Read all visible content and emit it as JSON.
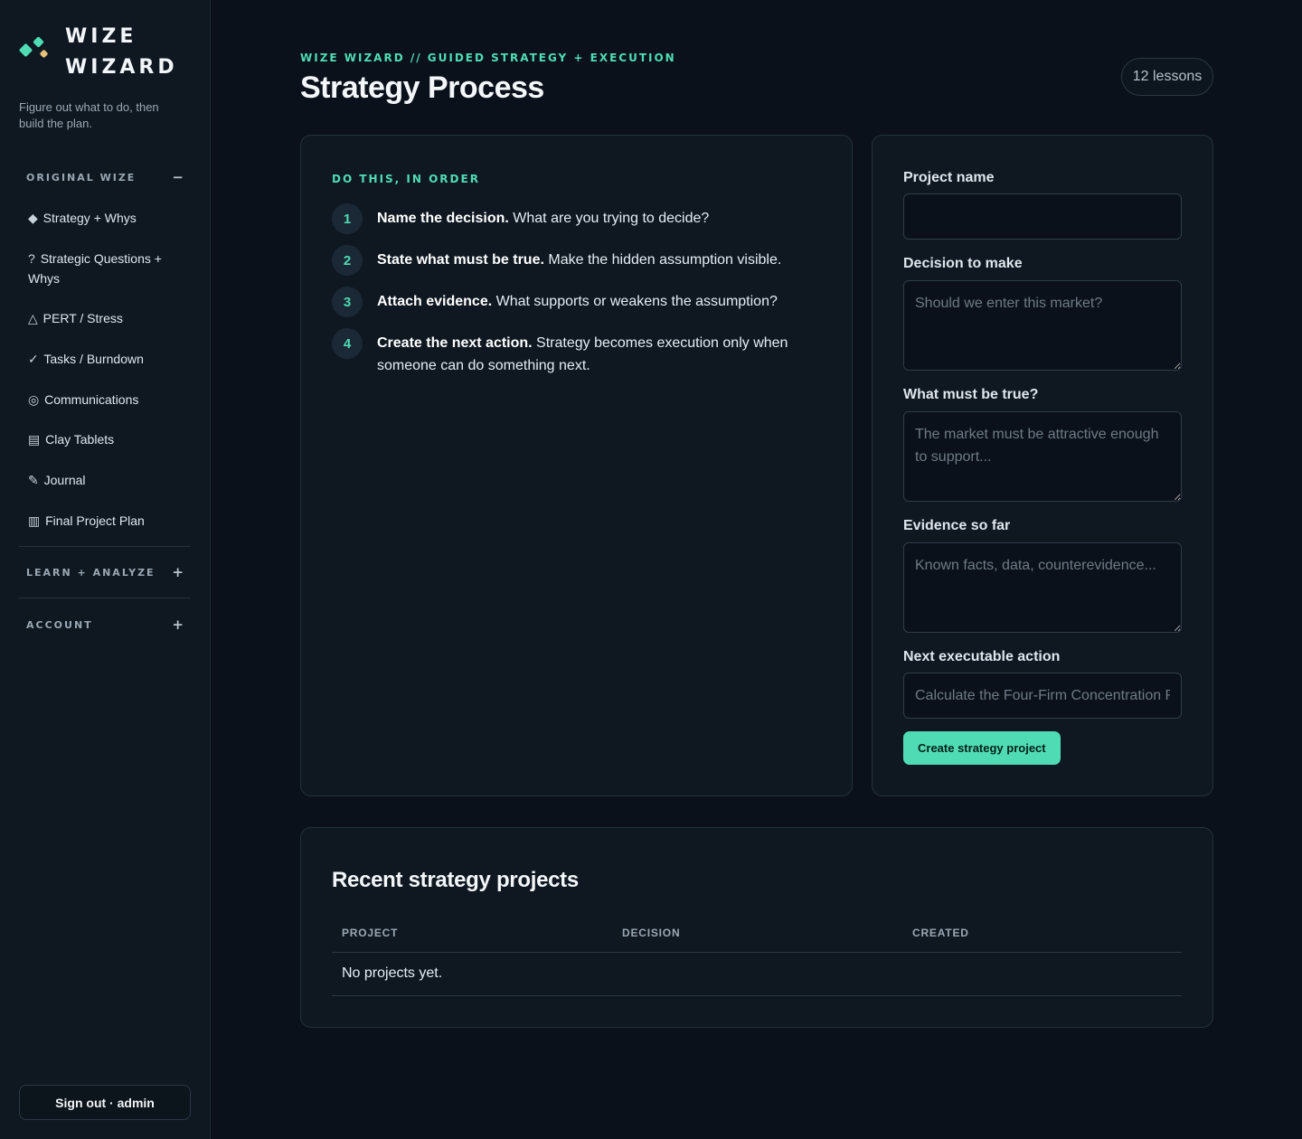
{
  "brand": {
    "line1": "WIZE",
    "line2": "WIZARD",
    "tagline": "Figure out what to do, then build the plan."
  },
  "sidebar": {
    "sections": [
      {
        "title": "ORIGINAL WIZE",
        "toggle": "−",
        "expanded": true
      },
      {
        "title": "LEARN + ANALYZE",
        "toggle": "+",
        "expanded": false
      },
      {
        "title": "ACCOUNT",
        "toggle": "+",
        "expanded": false
      }
    ],
    "items": [
      {
        "icon": "◆",
        "label": "Strategy + Whys"
      },
      {
        "icon": "?",
        "label": "Strategic Questions + Whys"
      },
      {
        "icon": "△",
        "label": "PERT / Stress"
      },
      {
        "icon": "✓",
        "label": "Tasks / Burndown"
      },
      {
        "icon": "◎",
        "label": "Communications"
      },
      {
        "icon": "▤",
        "label": "Clay Tablets"
      },
      {
        "icon": "✎",
        "label": "Journal"
      },
      {
        "icon": "▥",
        "label": "Final Project Plan"
      }
    ],
    "signout": "Sign out · admin"
  },
  "header": {
    "eyebrow": "WIZE WIZARD // GUIDED STRATEGY + EXECUTION",
    "title": "Strategy Process",
    "lessons": "12 lessons"
  },
  "steps": {
    "label": "DO THIS, IN ORDER",
    "items": [
      {
        "num": "1",
        "bold": "Name the decision.",
        "text": " What are you trying to decide?"
      },
      {
        "num": "2",
        "bold": "State what must be true.",
        "text": " Make the hidden assumption visible."
      },
      {
        "num": "3",
        "bold": "Attach evidence.",
        "text": " What supports or weakens the assumption?"
      },
      {
        "num": "4",
        "bold": "Create the next action.",
        "text": " Strategy becomes execution only when someone can do something next."
      }
    ]
  },
  "form": {
    "project_name": {
      "label": "Project name",
      "value": "",
      "placeholder": ""
    },
    "decision": {
      "label": "Decision to make",
      "placeholder": "Should we enter this market?"
    },
    "must_be_true": {
      "label": "What must be true?",
      "placeholder": "The market must be attractive enough to support..."
    },
    "evidence": {
      "label": "Evidence so far",
      "placeholder": "Known facts, data, counterevidence..."
    },
    "next_action": {
      "label": "Next executable action",
      "placeholder": "Calculate the Four-Firm Concentration Ratio"
    },
    "submit": "Create strategy project"
  },
  "recent": {
    "title": "Recent strategy projects",
    "columns": [
      "PROJECT",
      "DECISION",
      "CREATED"
    ],
    "empty": "No projects yet."
  },
  "colors": {
    "accent": "#4fdcb4",
    "accent_secondary": "#e8c27a",
    "background": "#0a111a",
    "panel": "#0f1821"
  }
}
